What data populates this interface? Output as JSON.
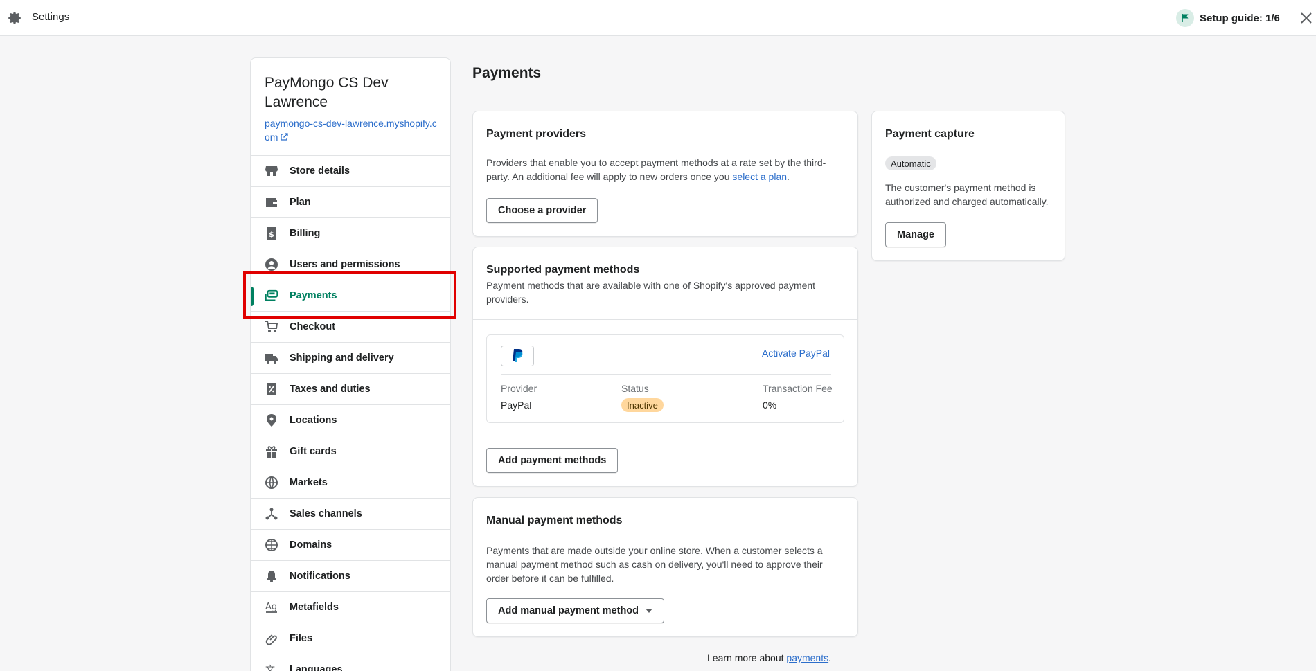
{
  "topbar": {
    "title": "Settings",
    "setup_guide": "Setup guide: 1/6",
    "icons": [
      "gear-icon",
      "flag-icon",
      "close-icon"
    ]
  },
  "store": {
    "name": "PayMongo CS Dev Lawrence",
    "url": "paymongo-cs-dev-lawrence.myshopify.com"
  },
  "nav": {
    "items": [
      {
        "label": "Store details",
        "icon": "store-icon"
      },
      {
        "label": "Plan",
        "icon": "plan-icon"
      },
      {
        "label": "Billing",
        "icon": "billing-icon"
      },
      {
        "label": "Users and permissions",
        "icon": "user-icon"
      },
      {
        "label": "Payments",
        "icon": "payments-icon",
        "active": true
      },
      {
        "label": "Checkout",
        "icon": "cart-icon"
      },
      {
        "label": "Shipping and delivery",
        "icon": "truck-icon"
      },
      {
        "label": "Taxes and duties",
        "icon": "tax-icon"
      },
      {
        "label": "Locations",
        "icon": "location-icon"
      },
      {
        "label": "Gift cards",
        "icon": "gift-icon"
      },
      {
        "label": "Markets",
        "icon": "markets-icon"
      },
      {
        "label": "Sales channels",
        "icon": "channels-icon"
      },
      {
        "label": "Domains",
        "icon": "globe-icon"
      },
      {
        "label": "Notifications",
        "icon": "bell-icon"
      },
      {
        "label": "Metafields",
        "icon": "metafields-icon"
      },
      {
        "label": "Files",
        "icon": "paperclip-icon"
      },
      {
        "label": "Languages",
        "icon": "language-icon"
      }
    ]
  },
  "main": {
    "title": "Payments",
    "providers": {
      "title": "Payment providers",
      "desc_before": "Providers that enable you to accept payment methods at a rate set by the third-party. An additional fee will apply to new orders once you ",
      "desc_link": "select a plan",
      "desc_after": ".",
      "button": "Choose a provider"
    },
    "supported": {
      "title": "Supported payment methods",
      "desc": "Payment methods that are available with one of Shopify's approved payment providers.",
      "paypal": {
        "activate": "Activate PayPal",
        "provider_h": "Provider",
        "status_h": "Status",
        "fee_h": "Transaction Fee",
        "provider_v": "PayPal",
        "status_v": "Inactive",
        "fee_v": "0%"
      },
      "button": "Add payment methods"
    },
    "manual": {
      "title": "Manual payment methods",
      "desc": "Payments that are made outside your online store. When a customer selects a manual payment method such as cash on delivery, you'll need to approve their order before it can be fulfilled.",
      "button": "Add manual payment method"
    },
    "capture": {
      "title": "Payment capture",
      "badge": "Automatic",
      "desc": "The customer's payment method is authorized and charged automatically.",
      "button": "Manage"
    },
    "learn_before": "Learn more about ",
    "learn_link": "payments",
    "learn_after": "."
  },
  "colors": {
    "accent": "#008060",
    "link": "#2c6ecb",
    "highlight": "#e00000",
    "inactive_badge": "#ffd79d"
  }
}
